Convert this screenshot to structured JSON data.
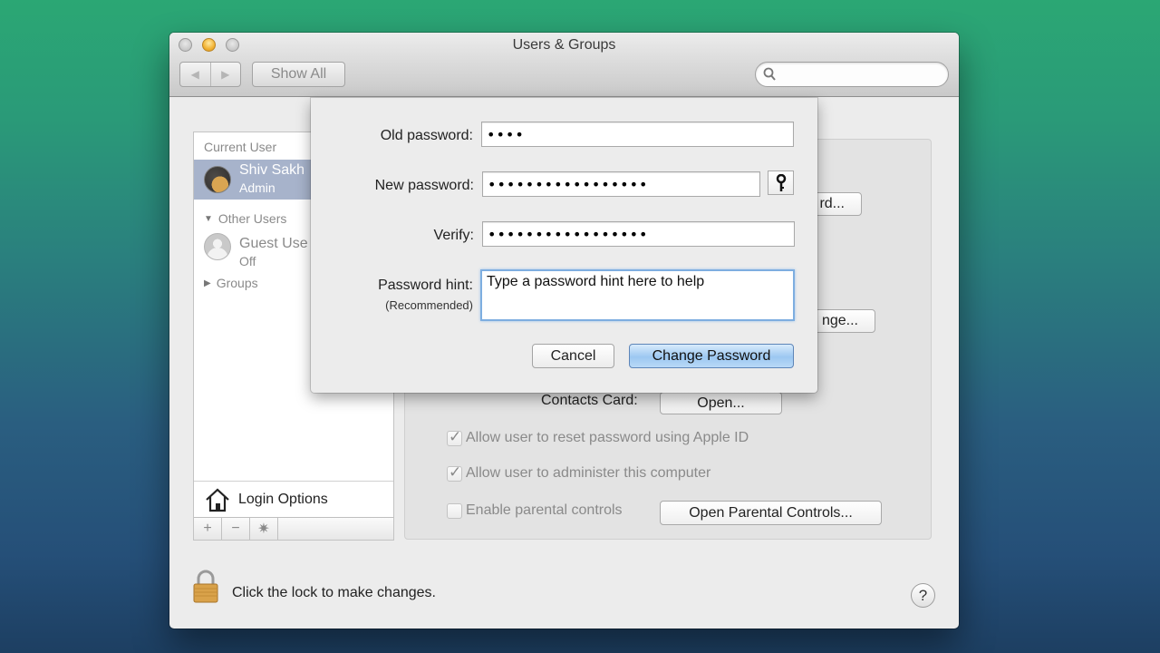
{
  "window": {
    "title": "Users & Groups",
    "show_all_label": "Show All",
    "search_placeholder": "",
    "back_icon": "◀",
    "forward_icon": "▶"
  },
  "sidebar": {
    "current_user_header": "Current User",
    "current_user": {
      "name": "Shiv Sakh",
      "role": "Admin"
    },
    "other_users_header": "Other Users",
    "guest": {
      "name": "Guest Use",
      "status": "Off"
    },
    "groups_label": "Groups",
    "login_options_label": "Login Options",
    "toolbar": {
      "add": "+",
      "remove": "−",
      "action": "✷"
    }
  },
  "detail": {
    "change_password_btn_partial": "rd...",
    "change_btn_partial": "nge...",
    "contacts_card_label": "Contacts Card:",
    "open_button": "Open...",
    "checkboxes": [
      {
        "label": "Allow user to reset password using Apple ID",
        "checked": true
      },
      {
        "label": "Allow user to administer this computer",
        "checked": true
      },
      {
        "label": "Enable parental controls",
        "checked": false
      }
    ],
    "parental_controls_button": "Open Parental Controls..."
  },
  "footer": {
    "lock_text": "Click the lock to make changes.",
    "help_label": "?"
  },
  "dialog": {
    "old_password_label": "Old password:",
    "old_password_value": "••••",
    "new_password_label": "New password:",
    "new_password_value": "•••••••••••••••••",
    "verify_label": "Verify:",
    "verify_value": "•••••••••••••••••",
    "hint_label": "Password hint:",
    "hint_sublabel": "(Recommended)",
    "hint_value": "Type a password hint here to help",
    "cancel_label": "Cancel",
    "change_password_label": "Change Password"
  },
  "colors": {
    "selection": "#a7b3cb",
    "default_button": "#9cc7f1",
    "focus_ring": "#7eaee0"
  }
}
